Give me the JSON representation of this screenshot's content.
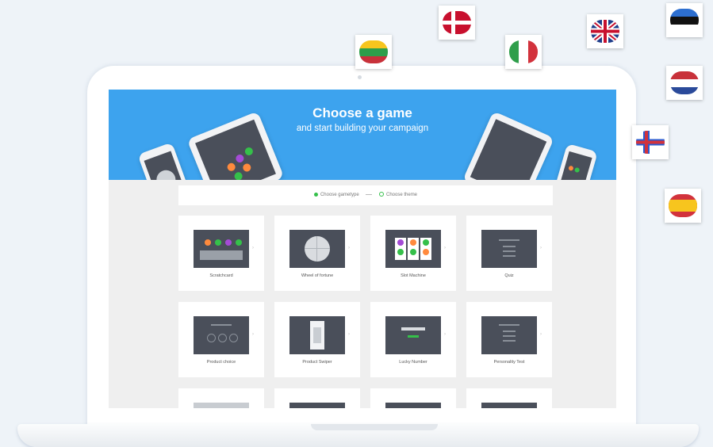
{
  "hero": {
    "title": "Choose a game",
    "subtitle": "and start building your campaign"
  },
  "steps": [
    {
      "label": "Choose gametype",
      "state": "active",
      "color": "#35c04a"
    },
    {
      "label": "Choose theme",
      "state": "inactive",
      "color": "#35c04a"
    }
  ],
  "games": [
    {
      "label": "Scratchcard",
      "icon": "scratchcard-icon"
    },
    {
      "label": "Wheel of fortune",
      "icon": "wheel-icon"
    },
    {
      "label": "Slot Machine",
      "icon": "slot-machine-icon"
    },
    {
      "label": "Quiz",
      "icon": "quiz-icon"
    },
    {
      "label": "Product choice",
      "icon": "product-choice-icon"
    },
    {
      "label": "Product Swiper",
      "icon": "product-swiper-icon"
    },
    {
      "label": "Lucky Number",
      "icon": "lucky-number-icon"
    },
    {
      "label": "Personality Test",
      "icon": "personality-test-icon"
    }
  ],
  "flags": [
    "lithuania",
    "denmark",
    "italy",
    "united-kingdom",
    "estonia",
    "netherlands",
    "faroe-islands",
    "spain"
  ],
  "colors": {
    "hero": "#3da3ee",
    "screen_bg": "#efefef",
    "thumb": "#4a4f5a",
    "accent_green": "#35c04a"
  }
}
